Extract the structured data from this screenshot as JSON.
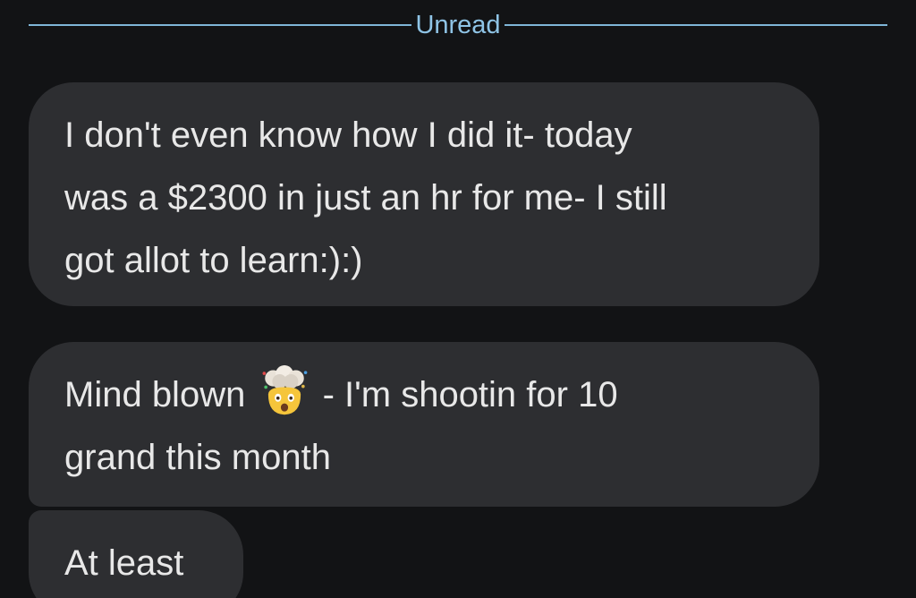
{
  "divider": {
    "label": "Unread",
    "color": "#8fc4e6"
  },
  "messages": [
    {
      "lines": [
        "I don't even know how I did it- today",
        "was a $2300 in just an hr for me- I still",
        "got allot to learn:):)"
      ]
    },
    {
      "line1_before_emoji": "Mind blown",
      "emoji": "exploding-head-icon",
      "line1_after_emoji": "- I'm shootin for 10",
      "line2": "grand this month"
    },
    {
      "lines": [
        "At least"
      ]
    }
  ],
  "colors": {
    "background": "#121315",
    "bubble": "#2d2e31",
    "text": "#e8e8e8",
    "divider_line": "#7fb6d8"
  }
}
